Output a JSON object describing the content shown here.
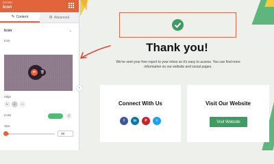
{
  "panel": {
    "kicker": "EDITING",
    "title": "Icon",
    "tabs": [
      {
        "label": "Content",
        "active": true
      },
      {
        "label": "Advanced",
        "active": false
      }
    ],
    "section_title": "Icon",
    "icon_label": "Icon",
    "align_label": "Align",
    "align_options": [
      "left",
      "center",
      "right"
    ],
    "align_selected": "center",
    "color_label": "Color",
    "color_value": "#4cbf74",
    "size_label": "Size",
    "size_value": "48",
    "size_slider_fraction": 0.1
  },
  "page": {
    "headline": "Thank you!",
    "subtext": "We've sent your free report to your inbox so it's easy to access. You can find more information on our website and social pages.",
    "success_icon": "check-icon",
    "cards": {
      "connect": {
        "title": "Connect With Us",
        "socials": [
          {
            "name": "facebook-icon",
            "glyph": "f",
            "color": "#3b5998"
          },
          {
            "name": "linkedin-icon",
            "glyph": "in",
            "color": "#0e76a8"
          },
          {
            "name": "pinterest-icon",
            "glyph": "P",
            "color": "#cb2027"
          },
          {
            "name": "twitter-icon",
            "glyph": "t",
            "color": "#1da1f2"
          }
        ]
      },
      "website": {
        "title": "Visit Our Website",
        "button_label": "Visit Website"
      }
    }
  },
  "colors": {
    "accent": "#e2643b",
    "green": "#3f9b62",
    "yellow": "#f3cb3c"
  }
}
